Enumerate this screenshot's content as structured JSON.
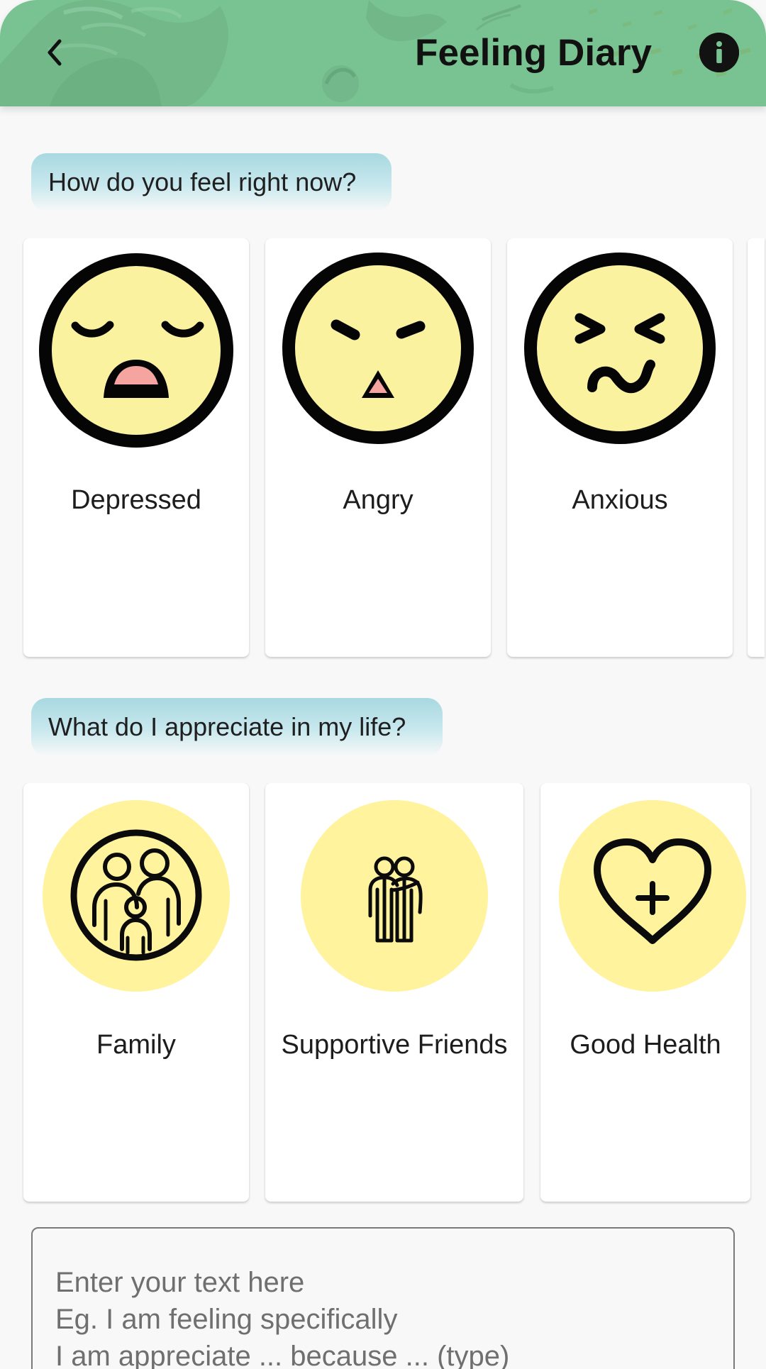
{
  "header": {
    "title": "Feeling Diary",
    "back_icon": "chevron-left-icon",
    "info_icon": "info-icon",
    "accent_color": "#79c291"
  },
  "feeling_section": {
    "question": "How do you feel right now?",
    "options": [
      {
        "label": "Depressed",
        "icon": "depressed-face-icon"
      },
      {
        "label": "Angry",
        "icon": "angry-face-icon"
      },
      {
        "label": "Anxious",
        "icon": "anxious-face-icon"
      }
    ]
  },
  "appreciation_section": {
    "question": "What do I appreciate in my life?",
    "options": [
      {
        "label": "Family",
        "icon": "family-icon"
      },
      {
        "label": "Supportive Friends",
        "icon": "friends-icon"
      },
      {
        "label": "Good Health",
        "icon": "heart-plus-icon"
      }
    ]
  },
  "text_input": {
    "placeholder_lines": [
      "Enter your text here",
      "Eg. I am feeling specifically",
      "I am appreciate ... because ... (type)"
    ]
  }
}
